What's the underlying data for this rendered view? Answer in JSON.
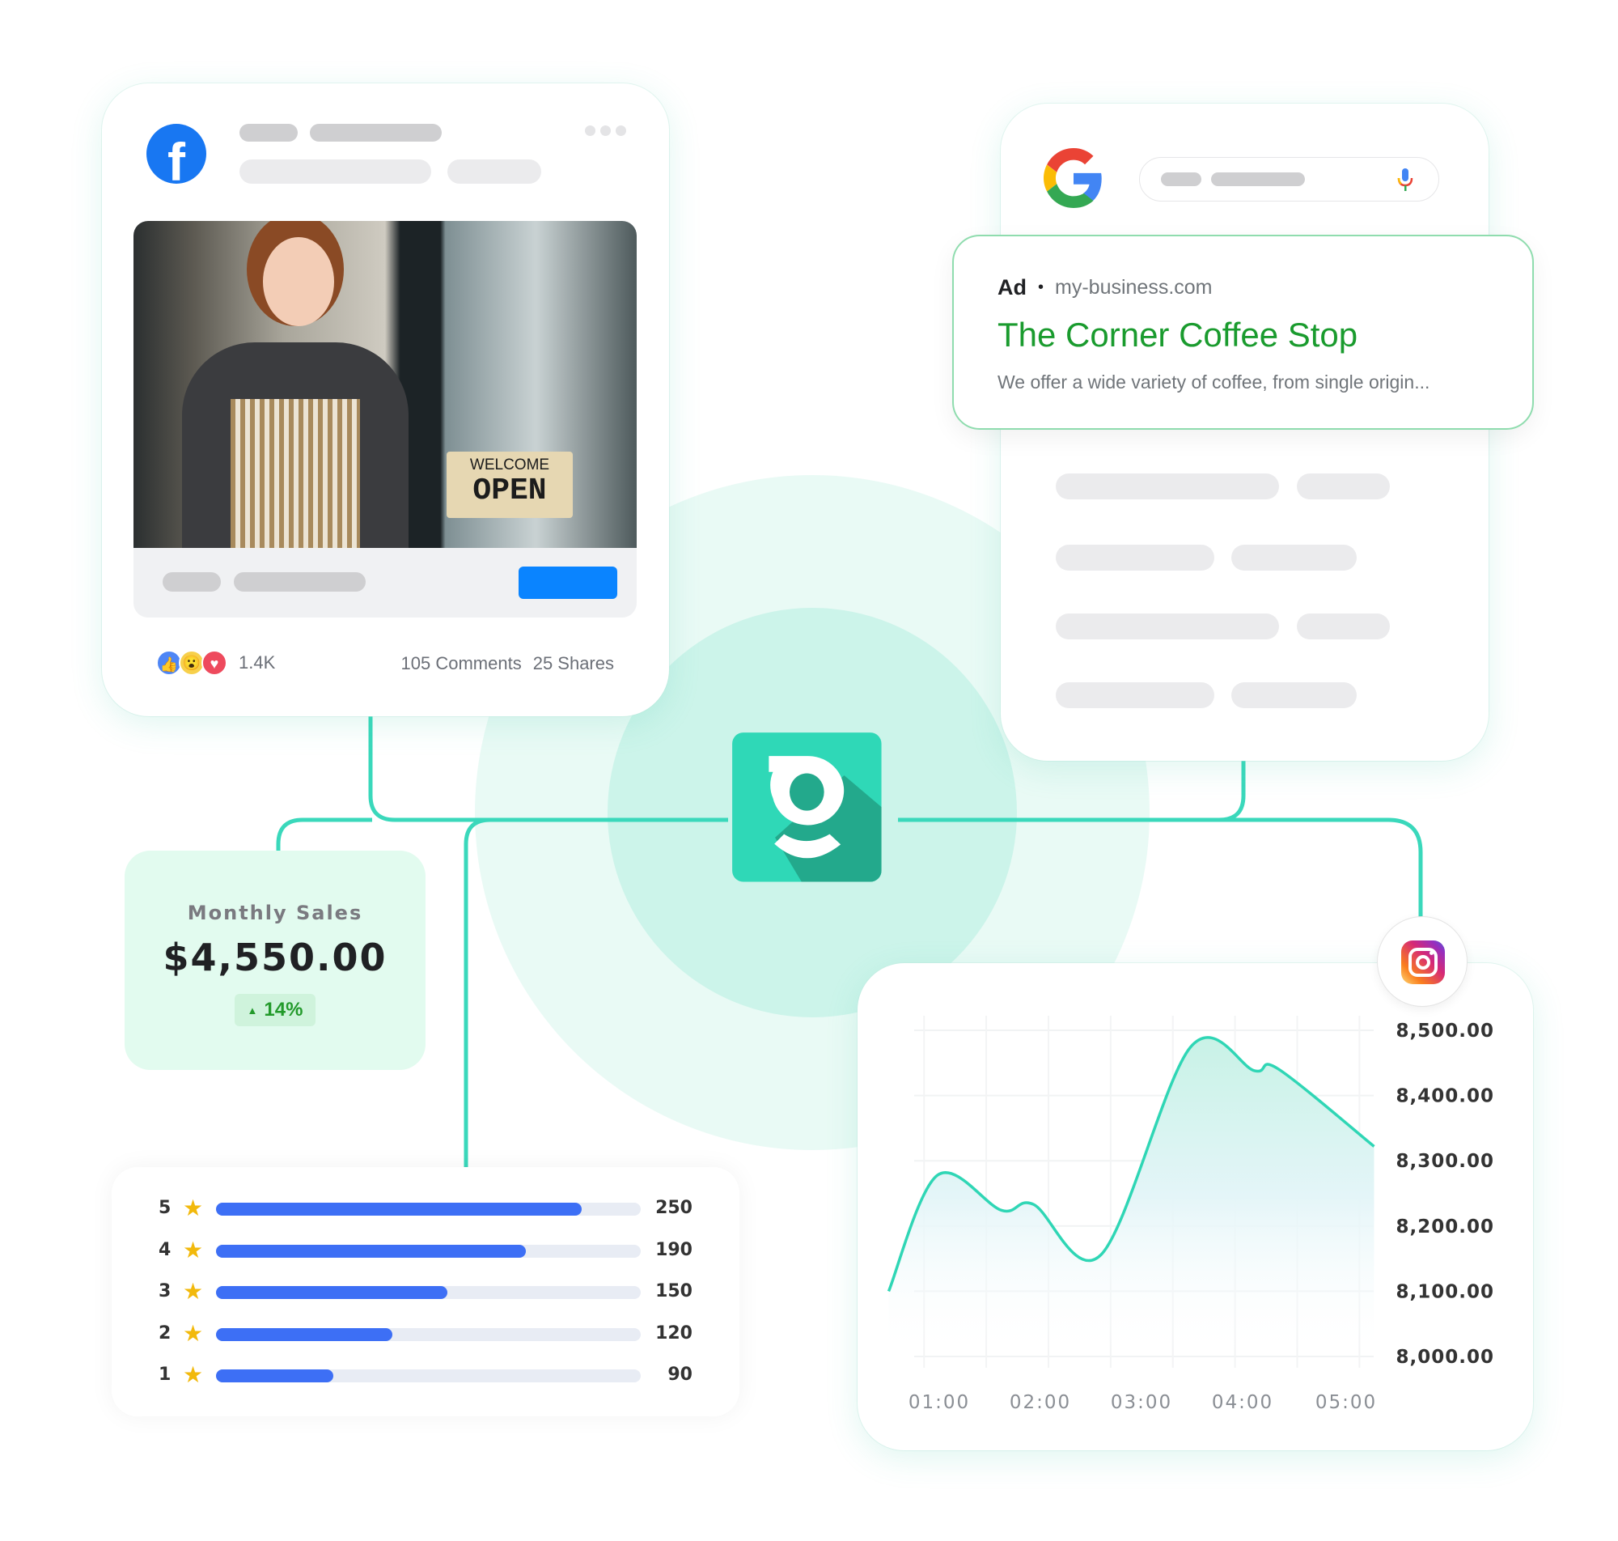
{
  "facebook_post": {
    "logo_icon": "facebook-logo-icon",
    "menu_icon": "more-dots-icon",
    "photo": {
      "sign_line1": "WELCOME",
      "sign_line2": "OPEN"
    },
    "reactions_icons": [
      "like-icon",
      "wow-icon",
      "love-icon"
    ],
    "reactions_count": "1.4K",
    "comments": "105 Comments",
    "shares": "25 Shares",
    "cta_color": "#0a84ff"
  },
  "google_search": {
    "logo_icon": "google-logo-icon",
    "mic_icon": "microphone-icon",
    "ad": {
      "label": "Ad",
      "separator": "•",
      "domain": "my-business.com",
      "title": "The Corner Coffee Stop",
      "description": "We offer a wide variety of coffee, from single origin..."
    }
  },
  "brand_logo_icon": "g-brand-logo-icon",
  "monthly_sales": {
    "label": "Monthly Sales",
    "value": "$4,550.00",
    "change": "14%",
    "change_direction": "up"
  },
  "ratings": [
    {
      "stars": "5",
      "count": "250",
      "fill": 0.86
    },
    {
      "stars": "4",
      "count": "190",
      "fill": 0.73
    },
    {
      "stars": "3",
      "count": "150",
      "fill": 0.545
    },
    {
      "stars": "2",
      "count": "120",
      "fill": 0.415
    },
    {
      "stars": "1",
      "count": "90",
      "fill": 0.276
    }
  ],
  "instagram_icon": "instagram-logo-icon",
  "chart_data": {
    "type": "area",
    "x_tick_labels": [
      "01:00",
      "02:00",
      "03:00",
      "04:00",
      "05:00"
    ],
    "y_tick_labels": [
      "8,500.00",
      "8,400.00",
      "8,300.00",
      "8,200.00",
      "8,100.00",
      "8,000.00"
    ],
    "ylim": [
      8000,
      8500
    ],
    "grid": true,
    "y_axis_side": "right",
    "line_color": "#2fd6b5",
    "points": [
      {
        "x": "00:30",
        "y": 8100
      },
      {
        "x": "00:59",
        "y": 8278
      },
      {
        "x": "01:37",
        "y": 8224
      },
      {
        "x": "01:56",
        "y": 8233
      },
      {
        "x": "02:36",
        "y": 8156
      },
      {
        "x": "03:29",
        "y": 8474
      },
      {
        "x": "04:07",
        "y": 8438
      },
      {
        "x": "04:21",
        "y": 8441
      },
      {
        "x": "05:18",
        "y": 8322
      }
    ]
  }
}
